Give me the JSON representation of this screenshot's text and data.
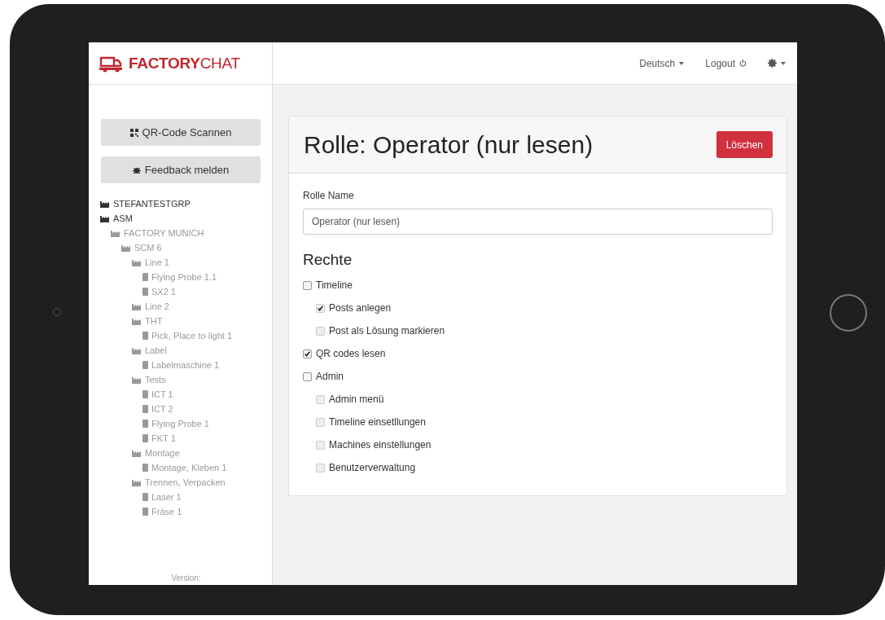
{
  "header": {
    "logo": {
      "strong": "FACTORY",
      "light": "CHAT"
    },
    "language": "Deutsch",
    "logout": "Logout"
  },
  "sidebar": {
    "buttons": [
      {
        "kind": "qr",
        "label": "QR-Code Scannen"
      },
      {
        "kind": "bug",
        "label": "Feedback melden"
      }
    ],
    "tree": [
      {
        "label": "STEFANTESTGRP",
        "kind": "group"
      },
      {
        "label": "ASM",
        "kind": "group",
        "children": [
          {
            "label": "FACTORY MUNICH",
            "kind": "group",
            "children": [
              {
                "label": "SCM 6",
                "kind": "group",
                "children": [
                  {
                    "label": "Line 1",
                    "kind": "group",
                    "children": [
                      {
                        "label": "Flying Probe 1.1",
                        "kind": "machine"
                      },
                      {
                        "label": "SX2 1",
                        "kind": "machine"
                      }
                    ]
                  },
                  {
                    "label": "Line 2",
                    "kind": "group"
                  },
                  {
                    "label": "THT",
                    "kind": "group",
                    "children": [
                      {
                        "label": "Pick, Place to light 1",
                        "kind": "machine"
                      }
                    ]
                  },
                  {
                    "label": "Label",
                    "kind": "group",
                    "children": [
                      {
                        "label": "Labelmaschine 1",
                        "kind": "machine"
                      }
                    ]
                  },
                  {
                    "label": "Tests",
                    "kind": "group",
                    "children": [
                      {
                        "label": "ICT 1",
                        "kind": "machine"
                      },
                      {
                        "label": "ICT 2",
                        "kind": "machine"
                      },
                      {
                        "label": "Flying Probe 1",
                        "kind": "machine"
                      },
                      {
                        "label": "FKT 1",
                        "kind": "machine"
                      }
                    ]
                  },
                  {
                    "label": "Montage",
                    "kind": "group",
                    "children": [
                      {
                        "label": "Montage, Kleben 1",
                        "kind": "machine"
                      }
                    ]
                  },
                  {
                    "label": "Trennen, Verpacken",
                    "kind": "group",
                    "children": [
                      {
                        "label": "Laser 1",
                        "kind": "machine"
                      },
                      {
                        "label": "Fräse 1",
                        "kind": "machine"
                      }
                    ]
                  }
                ]
              }
            ]
          }
        ]
      }
    ],
    "version": "Version:"
  },
  "card": {
    "title": "Rolle: Operator (nur lesen)",
    "delete_button": "Löschen",
    "name_label": "Rolle Name",
    "name_value": "Operator (nur lesen)",
    "rights": {
      "heading": "Rechte",
      "items": [
        {
          "label": "Timeline",
          "checked": false,
          "disabled": false,
          "children": [
            {
              "label": "Posts anlegen",
              "checked": true,
              "disabled": true
            },
            {
              "label": "Post als Lösung markieren",
              "checked": false,
              "disabled": true
            }
          ]
        },
        {
          "label": "QR codes lesen",
          "checked": true,
          "disabled": false
        },
        {
          "label": "Admin",
          "checked": false,
          "disabled": false,
          "children": [
            {
              "label": "Admin menü",
              "checked": false,
              "disabled": true
            },
            {
              "label": "Timeline einsetllungen",
              "checked": false,
              "disabled": true
            },
            {
              "label": "Machines einstellungen",
              "checked": false,
              "disabled": true
            },
            {
              "label": "Benutzerverwaltung",
              "checked": false,
              "disabled": true
            }
          ]
        }
      ]
    }
  }
}
